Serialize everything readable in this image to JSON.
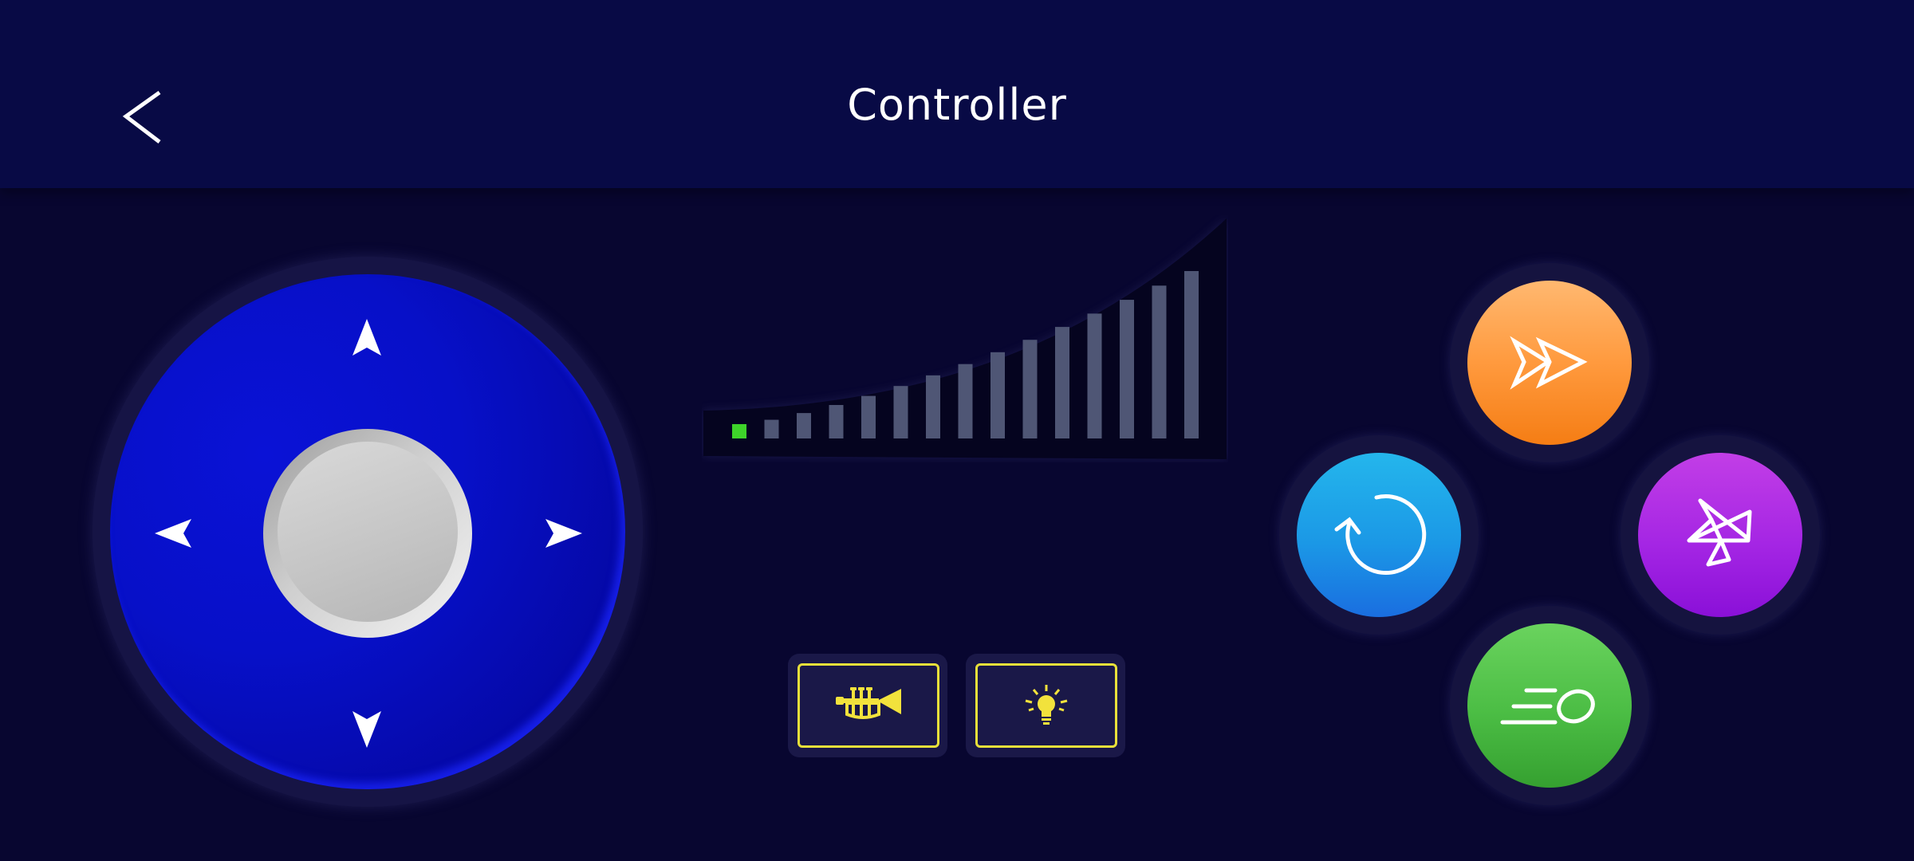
{
  "header": {
    "title": "Controller",
    "back_icon": "chevron-left-icon"
  },
  "joystick": {
    "arrows": [
      "arrow-up-icon",
      "arrow-down-icon",
      "arrow-left-icon",
      "arrow-right-icon"
    ],
    "pad_color": "#0710c8",
    "knob_color": "#c8c8c8"
  },
  "speed_meter": {
    "total_levels": 15,
    "current_level": 1,
    "active_color": "#3ed42a",
    "inactive_color": "#4f5675"
  },
  "tools": [
    {
      "icon": "trumpet-icon",
      "color": "#f2e23c"
    },
    {
      "icon": "lightbulb-icon",
      "color": "#f2e23c"
    }
  ],
  "actions": [
    {
      "icon": "fast-forward-icon",
      "color": "#ff9a3e"
    },
    {
      "icon": "rotate-icon",
      "color": "#1b98e6"
    },
    {
      "icon": "scatter-arrows-icon",
      "color": "#a526e4"
    },
    {
      "icon": "dash-ball-icon",
      "color": "#4bbd44"
    }
  ]
}
